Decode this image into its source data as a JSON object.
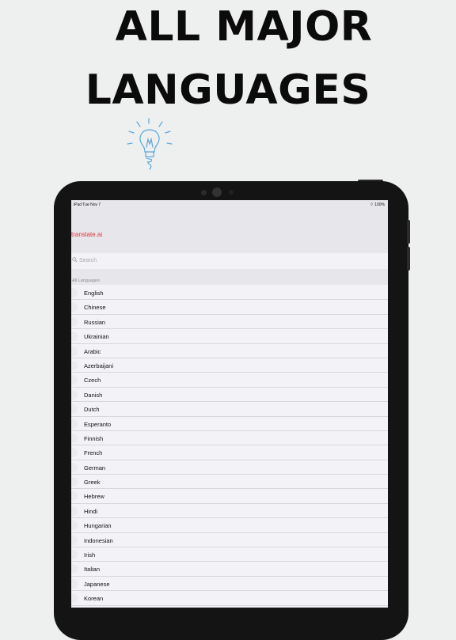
{
  "headline": {
    "line1": "ALL MAJOR",
    "line2": "LANGUAGES"
  },
  "status": {
    "time": "iPad   Tue Nov 7",
    "battery": "100%"
  },
  "app": {
    "title": "translate.ai"
  },
  "search": {
    "placeholder": "Search"
  },
  "section": {
    "label": "All Languages"
  },
  "languages": [
    "English",
    "Chinese",
    "Russian",
    "Ukrainian",
    "Arabic",
    "Azerbaijani",
    "Czech",
    "Danish",
    "Dutch",
    "Esperanto",
    "Finnish",
    "French",
    "German",
    "Greek",
    "Hebrew",
    "Hindi",
    "Hungarian",
    "Indonesian",
    "Irish",
    "Italian",
    "Japanese",
    "Korean"
  ],
  "colors": {
    "accent": "#e0373d",
    "bulb": "#5aa6de"
  }
}
